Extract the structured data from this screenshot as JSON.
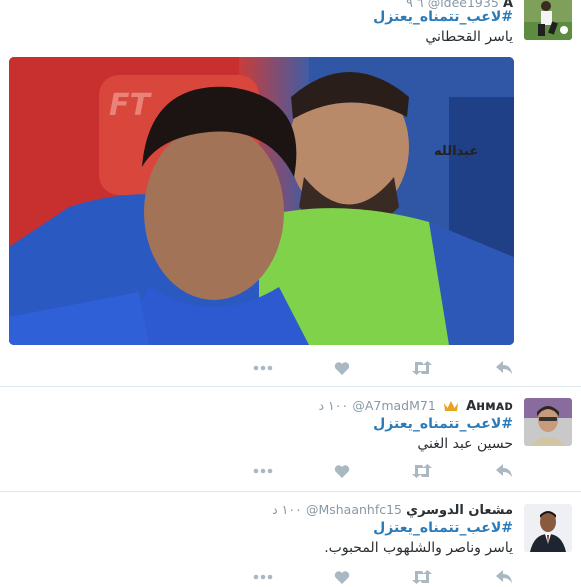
{
  "colors": {
    "link": "#2b7bb9",
    "muted": "#8899a6",
    "icon": "#aab8c2",
    "verified": "#e8a321",
    "divider": "#e1e8ed"
  },
  "tweets": [
    {
      "name": "A",
      "handle": "@ldee1935",
      "time": "٦ ٩",
      "hashtag": "#لاعب_تتمناه_يعتزل",
      "text": "ياسر القحطاني",
      "avatar_icon": "soccer-player-avatar",
      "media_watermark": "عبدالله"
    },
    {
      "name": "Aʜᴍᴀᴅ",
      "badge_icon": "crown-icon",
      "handle": "@A7madM71",
      "time": "١٠٠ د",
      "hashtag": "#لاعب_تتمناه_يعتزل",
      "text": "حسين عبد الغني",
      "avatar_icon": "man-avatar"
    },
    {
      "name": "مشعان الدوسري",
      "handle": "@Mshaanhfc15",
      "time": "١٠٠ د",
      "hashtag": "#لاعب_تتمناه_يعتزل",
      "text": "ياسر وناصر والشلهوب المحبوب.",
      "avatar_icon": "man-suit-avatar"
    }
  ],
  "action_icons": [
    "more-icon",
    "like-heart-icon",
    "retweet-icon",
    "reply-icon"
  ]
}
